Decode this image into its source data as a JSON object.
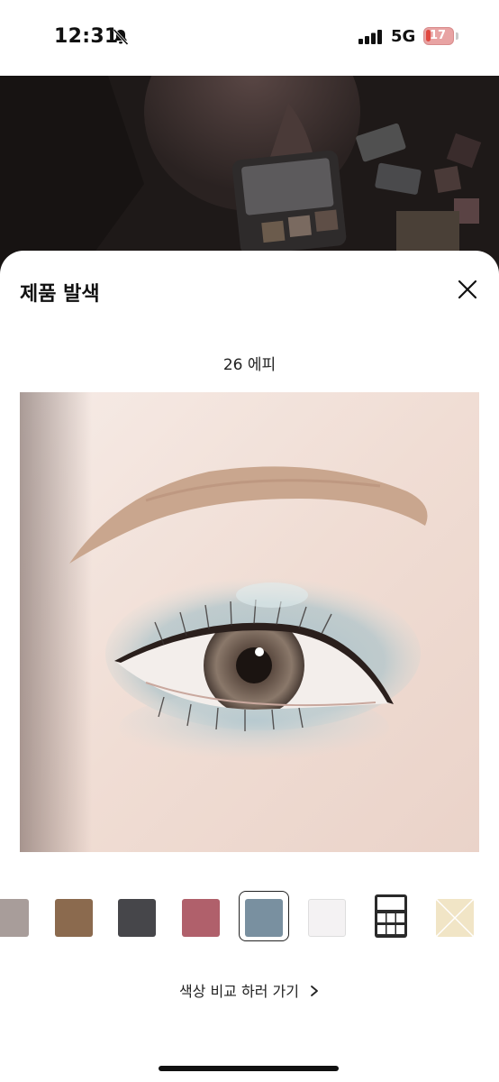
{
  "status_bar": {
    "time": "12:31",
    "network": "5G",
    "battery": "17",
    "battery_level": 0.17,
    "icons": [
      "bell-slash-icon",
      "signal-bars-icon",
      "battery-charging-icon"
    ]
  },
  "sheet": {
    "title": "제품 발색",
    "close_icon": "close-icon",
    "shade_name": "26 에피",
    "compare_link": "색상 비교 하러 가기",
    "compare_icon": "chevron-right-icon"
  },
  "swatches": [
    {
      "name": "swatch-1",
      "color": "#a89d9a",
      "selected": false
    },
    {
      "name": "swatch-2",
      "color": "#8b6a4e",
      "selected": false
    },
    {
      "name": "swatch-3",
      "color": "#46464a",
      "selected": false
    },
    {
      "name": "swatch-4",
      "color": "#b0606b",
      "selected": false
    },
    {
      "name": "swatch-5",
      "color": "#7990a0",
      "selected": true
    },
    {
      "name": "swatch-6",
      "color": "#f4f2f3",
      "selected": false
    },
    {
      "name": "palette",
      "color": "#222222",
      "selected": false
    },
    {
      "name": "swatch-8",
      "color": "#f1e5c6",
      "selected": false
    }
  ],
  "colors": {
    "accent": "#111111",
    "background": "#ffffff",
    "skin": "#f1dfd6",
    "eyeshadow": "#9fb6be"
  }
}
